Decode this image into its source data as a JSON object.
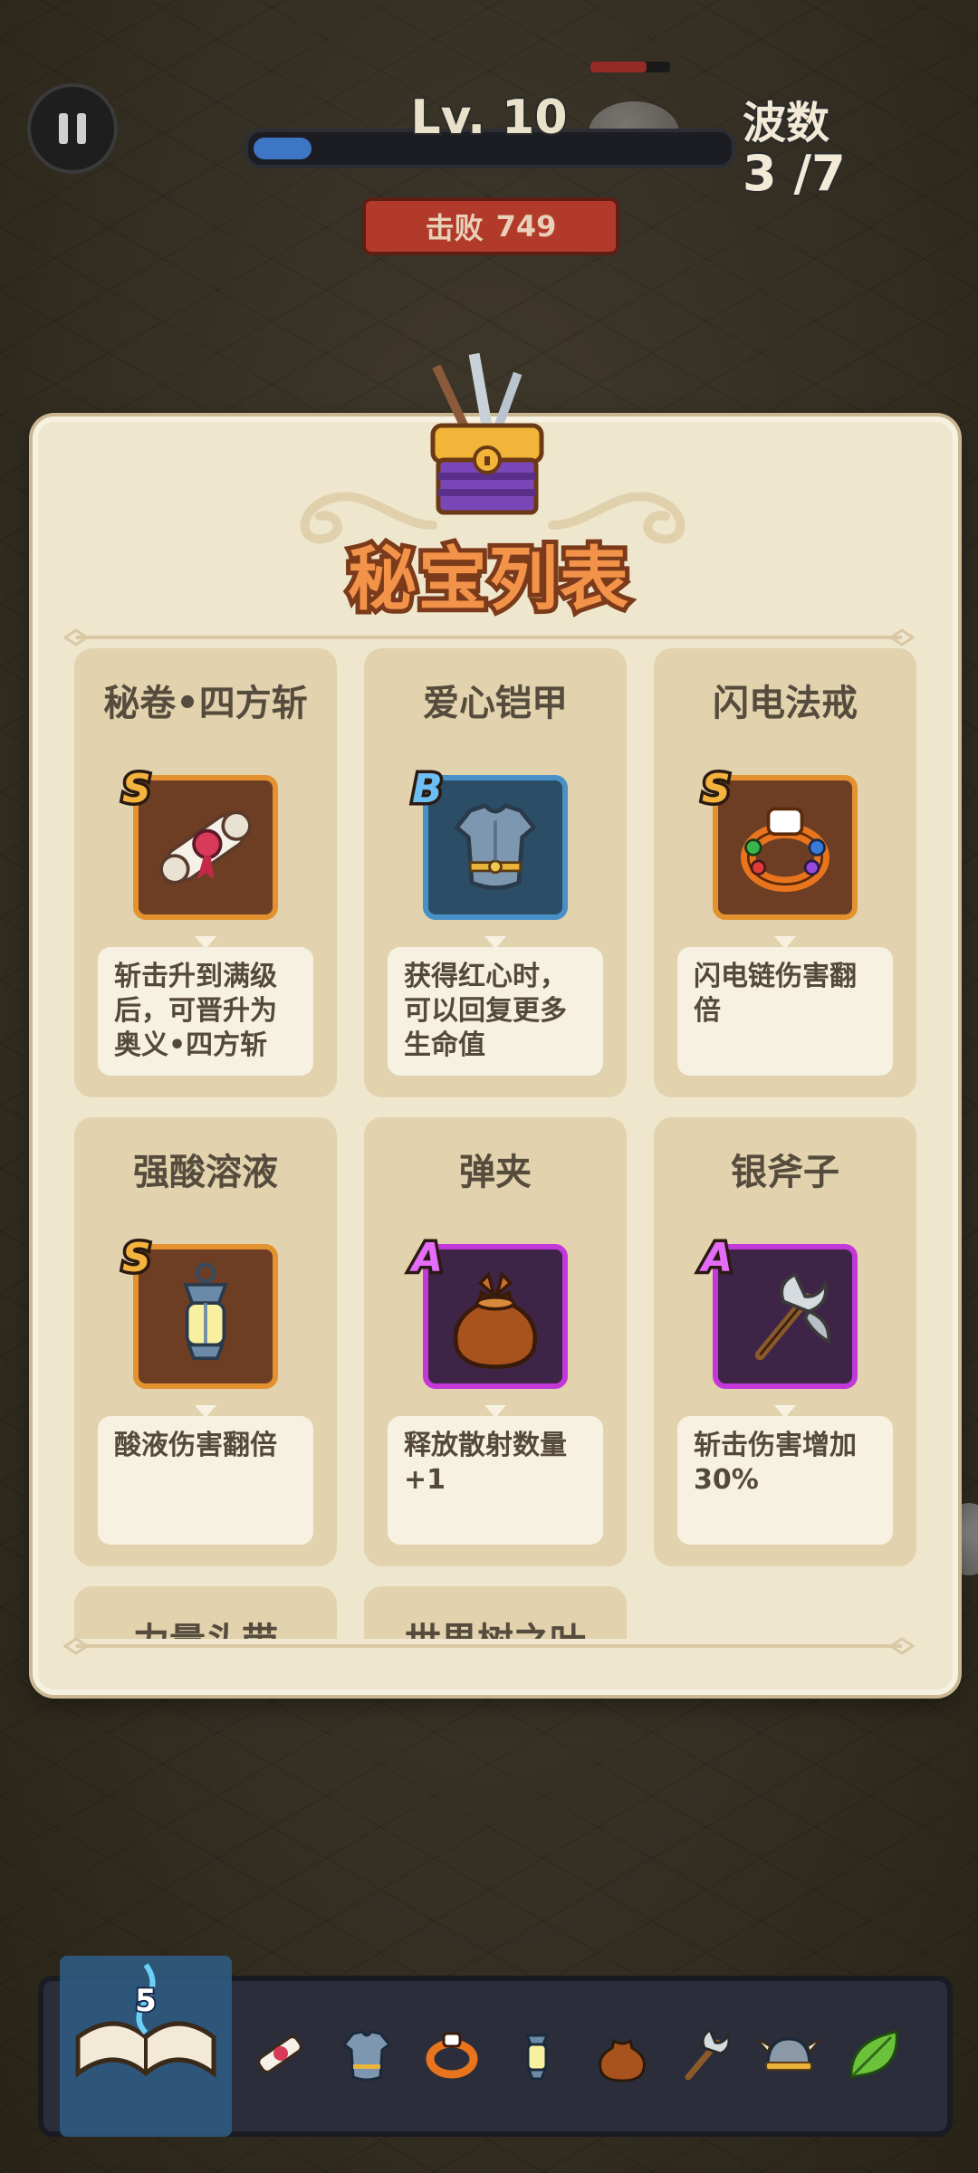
{
  "hud": {
    "level_text": "Lv. 10",
    "xp_progress": 0.12,
    "wave_label": "波数",
    "wave_value": "3 /7",
    "kills_label": "击败",
    "kills_value": "749"
  },
  "panel": {
    "title": "秘宝列表",
    "cards": [
      {
        "name": "秘卷•四方斩",
        "rank": "S",
        "icon": "scroll-icon",
        "desc": "斩击升到满级后，可晋升为奥义•四方斩"
      },
      {
        "name": "爱心铠甲",
        "rank": "B",
        "icon": "armor-icon",
        "desc": "获得红心时，可以回复更多生命值"
      },
      {
        "name": "闪电法戒",
        "rank": "S",
        "icon": "ring-icon",
        "desc": "闪电链伤害翻倍"
      },
      {
        "name": "强酸溶液",
        "rank": "S",
        "icon": "lantern-icon",
        "desc": "酸液伤害翻倍"
      },
      {
        "name": "弹夹",
        "rank": "A",
        "icon": "pouch-icon",
        "desc": "释放散射数量+1"
      },
      {
        "name": "银斧子",
        "rank": "A",
        "icon": "axe-icon",
        "desc": "斩击伤害增加30%"
      },
      {
        "name": "力量头带",
        "rank": "",
        "icon": "",
        "desc": ""
      },
      {
        "name": "世界树之叶",
        "rank": "",
        "icon": "",
        "desc": ""
      }
    ]
  },
  "inventory": {
    "book_count": "5",
    "items": [
      "scroll-icon",
      "armor-icon",
      "ring-icon",
      "lantern-icon",
      "pouch-icon",
      "axe-icon",
      "helmet-icon",
      "leaf-icon"
    ]
  },
  "colors": {
    "rank_S": "#e3922f",
    "rank_B": "#4a90c8",
    "rank_A": "#c238d9",
    "title": "#f3934a"
  }
}
